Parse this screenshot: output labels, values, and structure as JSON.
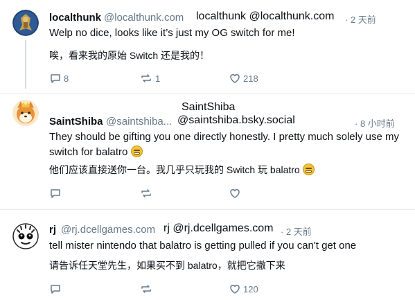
{
  "posts": [
    {
      "name": "localthunk",
      "handle": "@localthunk.com",
      "tooltip": "localthunk @localthunk.com",
      "time": "· 2 天前",
      "text": "Welp no dice, looks like it’s just my OG switch for me!",
      "translation": "唉，看来我的原始 Switch 还是我的！",
      "replies": "8",
      "reposts": "1",
      "likes": "218"
    },
    {
      "tooltip_name": "SaintShiba",
      "name": "SaintShiba",
      "handle": "@saintshiba...",
      "tooltip": "@saintshiba.bsky.social",
      "time": "· 8 小时前",
      "text": "They should be gifting you one directly honestly. I pretty much solely use my switch for balatro",
      "translation": "他们应该直接送你一台。我几乎只玩我的 Switch 玩 balatro",
      "replies": "",
      "reposts": "",
      "likes": ""
    },
    {
      "name": "rj",
      "handle": "@rj.dcellgames.com",
      "tooltip": "rj @rj.dcellgames.com",
      "time": "· 2 天前",
      "text": "tell mister nintendo that balatro is getting pulled if you can't get one",
      "translation": "请告诉任天堂先生，如果买不到 balatro，就把它撤下来",
      "replies": "",
      "reposts": "",
      "likes": "120"
    }
  ],
  "icons": {
    "reply": "speech-bubble-icon",
    "repost": "repost-arrows-icon",
    "like": "heart-icon",
    "emoji": "grimacing-face-emoji",
    "more": "ellipsis-icon"
  },
  "colors": {
    "text": "#0b0f14",
    "muted": "#66788a",
    "divider": "#e6e9ee"
  }
}
